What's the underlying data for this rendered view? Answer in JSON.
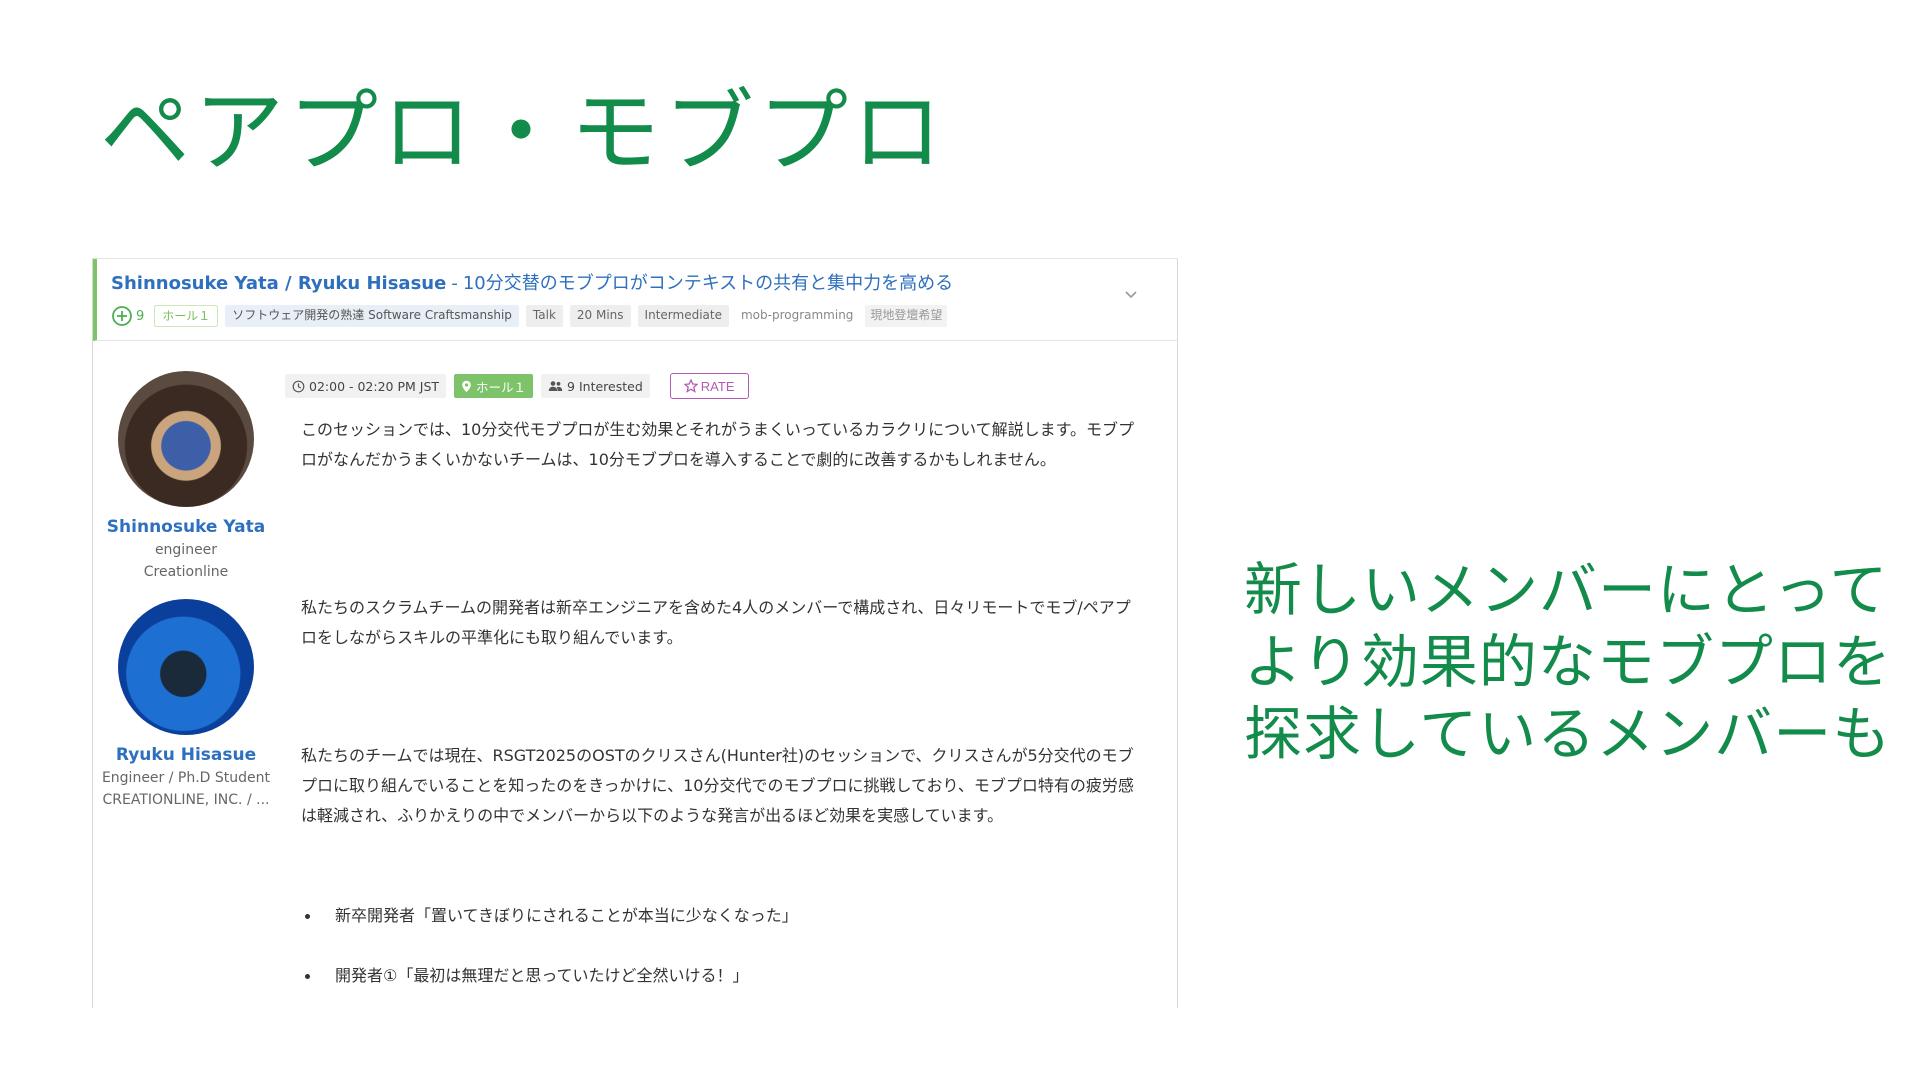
{
  "slide": {
    "title": "ペアプロ・モブプロ",
    "side_text": [
      "新しいメンバーにとって",
      "より効果的なモブプロを",
      "探求しているメンバーも"
    ]
  },
  "session": {
    "speakers_label": "Shinnosuke Yata / Ryuku Hisasue",
    "separator": "-",
    "title": "10分交替のモブプロがコンテキストの共有と集中力を高める",
    "favorite_count": "9",
    "tags": {
      "room": "ホール１",
      "track": "ソフトウェア開発の熟達 Software Craftsmanship",
      "format": "Talk",
      "length": "20 Mins",
      "level": "Intermediate",
      "topic": "mob-programming",
      "onsite": "現地登壇希望"
    },
    "time": "02:00 - 02:20 PM JST",
    "room_chip": "ホール１",
    "interested": "9 Interested",
    "rate_label": "RATE",
    "description": [
      "このセッションでは、10分交代モブプロが生む効果とそれがうまくいっているカラクリについて解説します。モブプロがなんだかうまくいかないチームは、10分モブプロを導入することで劇的に改善するかもしれません。",
      "私たちのスクラムチームの開発者は新卒エンジニアを含めた4人のメンバーで構成され、日々リモートでモブ/ペアプロをしながらスキルの平準化にも取り組んでいます。",
      "私たちのチームでは現在、RSGT2025のOSTのクリスさん(Hunter社)のセッションで、クリスさんが5分交代のモブプロに取り組んでいることを知ったのをきっかけに、10分交代でのモブプロに挑戦しており、モブプロ特有の疲労感は軽減され、ふりかえりの中でメンバーから以下のような発言が出るほど効果を実感しています。"
    ],
    "quotes": [
      "新卒開発者「置いてきぼりにされることが本当に少なくなった」",
      "開発者①「最初は無理だと思っていたけど全然いける！」"
    ]
  },
  "speakers": [
    {
      "name": "Shinnosuke Yata",
      "role": "engineer",
      "company": "Creationline"
    },
    {
      "name": "Ryuku Hisasue",
      "role": "Engineer / Ph.D Student",
      "company": "CREATIONLINE, INC. / ..."
    }
  ],
  "colors": {
    "accent_green": "#138b4a",
    "link_blue": "#2e6fbe",
    "room_green": "#7cc36a",
    "rate_purple": "#b45ab5"
  }
}
